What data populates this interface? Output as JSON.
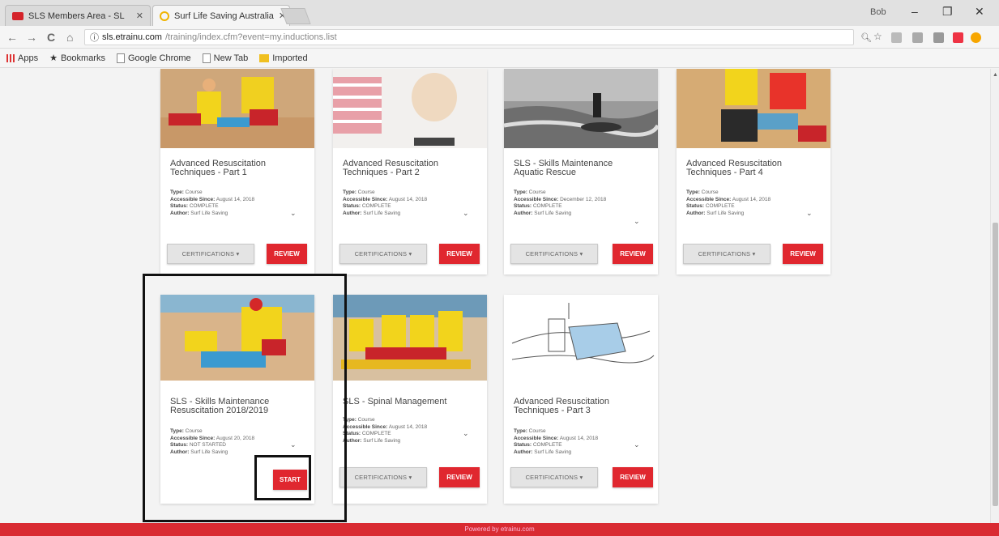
{
  "browser": {
    "tabs": [
      {
        "title": "SLS Members Area - SL"
      },
      {
        "title": "Surf Life Saving Australia"
      }
    ],
    "user_label": "Bob",
    "window_controls": {
      "minimize": "–",
      "maximize": "❐",
      "close": "✕"
    },
    "nav": {
      "back": "←",
      "forward": "→",
      "reload": "C",
      "home": "⌂"
    },
    "url_host": "sls.etrainu.com",
    "url_path": "/training/index.cfm?event=my.inductions.list",
    "url_secure_icon": "ⓘ",
    "bookmarks": [
      "Apps",
      "Bookmarks",
      "Google Chrome",
      "New Tab",
      "Imported"
    ]
  },
  "cards": [
    {
      "title": "Advanced Resuscitation Techniques - Part 1",
      "type": "Course",
      "accessible_since": "August 14, 2018",
      "status": "COMPLETE",
      "author": "Surf Life Saving",
      "cert_label": "CERTIFICATIONS ▾",
      "action_label": "REVIEW"
    },
    {
      "title": "Advanced Resuscitation Techniques - Part 2",
      "type": "Course",
      "accessible_since": "August 14, 2018",
      "status": "COMPLETE",
      "author": "Surf Life Saving",
      "cert_label": "CERTIFICATIONS ▾",
      "action_label": "REVIEW"
    },
    {
      "title": "SLS - Skills Maintenance Aquatic Rescue",
      "type": "Course",
      "accessible_since": "December 12, 2018",
      "status": "COMPLETE",
      "author": "Surf Life Saving",
      "cert_label": "CERTIFICATIONS ▾",
      "action_label": "REVIEW"
    },
    {
      "title": "Advanced Resuscitation Techniques - Part 4",
      "type": "Course",
      "accessible_since": "August 14, 2018",
      "status": "COMPLETE",
      "author": "Surf Life Saving",
      "cert_label": "CERTIFICATIONS ▾",
      "action_label": "REVIEW"
    },
    {
      "title": "SLS - Skills Maintenance Resuscitation 2018/2019",
      "type": "Course",
      "accessible_since": "August 20, 2018",
      "status": "NOT STARTED",
      "author": "Surf Life Saving",
      "action_label": "START"
    },
    {
      "title": "SLS - Spinal Management",
      "type": "Course",
      "accessible_since": "August 14, 2018",
      "status": "COMPLETE",
      "author": "Surf Life Saving",
      "cert_label": "CERTIFICATIONS ▾",
      "action_label": "REVIEW"
    },
    {
      "title": "Advanced Resuscitation Techniques - Part 3",
      "type": "Course",
      "accessible_since": "August 14, 2018",
      "status": "COMPLETE",
      "author": "Surf Life Saving",
      "cert_label": "CERTIFICATIONS ▾",
      "action_label": "REVIEW"
    }
  ],
  "labels": {
    "type": "Type:",
    "accessible": "Accessible Since:",
    "status": "Status:",
    "author": "Author:"
  },
  "footer": "Powered by etrainu.com",
  "colors": {
    "brand_red": "#e0272f",
    "footer_red": "#d92b32"
  }
}
